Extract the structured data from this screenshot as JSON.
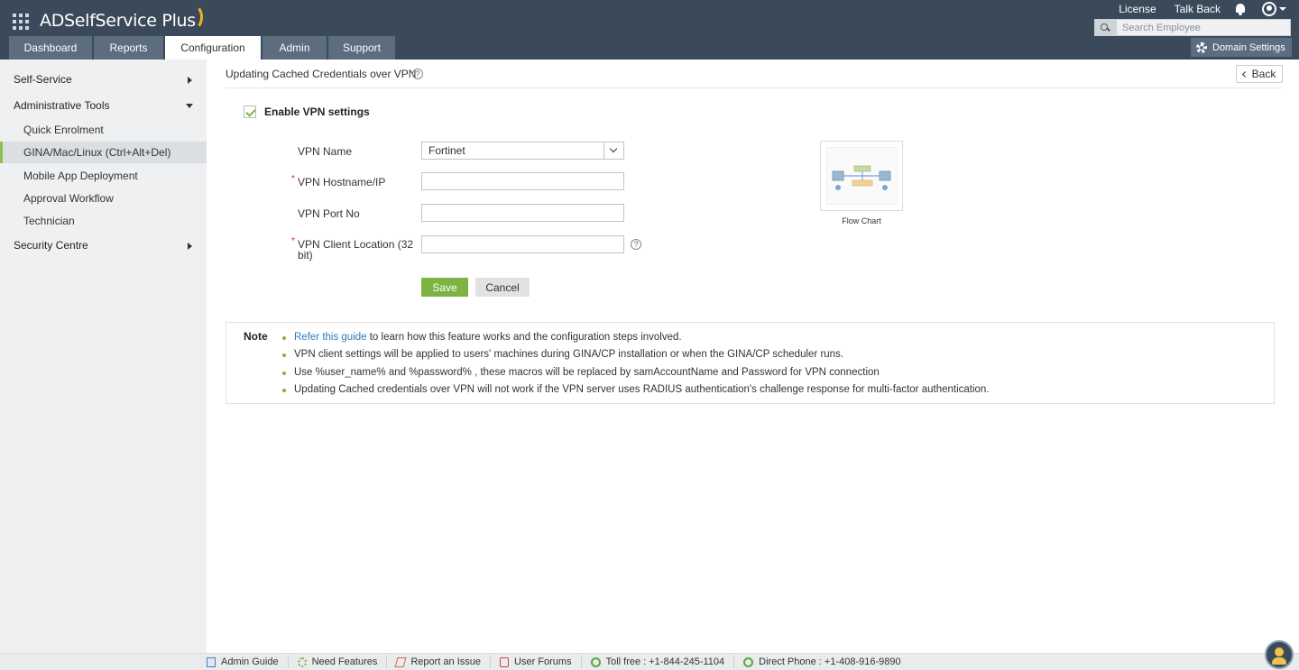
{
  "app": {
    "name": "ADSelfService Plus"
  },
  "topbar": {
    "links": [
      "License",
      "Talk Back"
    ],
    "search_placeholder": "Search Employee",
    "domain_settings": "Domain Settings"
  },
  "tabs": [
    {
      "label": "Dashboard",
      "active": false
    },
    {
      "label": "Reports",
      "active": false
    },
    {
      "label": "Configuration",
      "active": true
    },
    {
      "label": "Admin",
      "active": false
    },
    {
      "label": "Support",
      "active": false
    }
  ],
  "sidebar": {
    "categories": {
      "self_service": "Self-Service",
      "administrative_tools": "Administrative Tools",
      "security_centre": "Security Centre"
    },
    "items": [
      {
        "label": "Quick Enrolment",
        "active": false
      },
      {
        "label": "GINA/Mac/Linux (Ctrl+Alt+Del)",
        "active": true
      },
      {
        "label": "Mobile App Deployment",
        "active": false
      },
      {
        "label": "Approval Workflow",
        "active": false
      },
      {
        "label": "Technician",
        "active": false
      }
    ]
  },
  "page": {
    "title": "Updating Cached Credentials over VPN",
    "back": "Back",
    "enable_label": "Enable VPN settings",
    "enabled": true
  },
  "form": {
    "vpn_name_label": "VPN Name",
    "vpn_name_value": "Fortinet",
    "hostname_label": "VPN Hostname/IP",
    "hostname_value": "",
    "port_label": "VPN Port No",
    "port_value": "",
    "client_location_label": "VPN Client Location (32 bit)",
    "client_location_value": "",
    "save": "Save",
    "cancel": "Cancel"
  },
  "flowchart": {
    "caption": "Flow Chart"
  },
  "note": {
    "label": "Note",
    "link_text": "Refer this guide",
    "item1_rest": " to learn how this feature works and the configuration steps involved.",
    "item2": "VPN client settings will be applied to users' machines during GINA/CP installation or when the GINA/CP scheduler runs.",
    "item3": "Use %user_name% and %password% , these macros will be replaced by samAccountName and Password for VPN connection",
    "item4": "Updating Cached credentials over VPN will not work if the VPN server uses RADIUS authentication's challenge response for multi-factor authentication."
  },
  "footer": {
    "admin_guide": "Admin Guide",
    "need_features": "Need Features",
    "report_issue": "Report an Issue",
    "user_forums": "User Forums",
    "toll_free": "Toll free : +1-844-245-1104",
    "direct_phone": "Direct Phone : +1-408-916-9890"
  },
  "colors": {
    "header_bg": "#3a4a5a",
    "tab_bg": "#5b6d7f",
    "accent_green": "#7cb342",
    "link_blue": "#2a7bbf"
  }
}
